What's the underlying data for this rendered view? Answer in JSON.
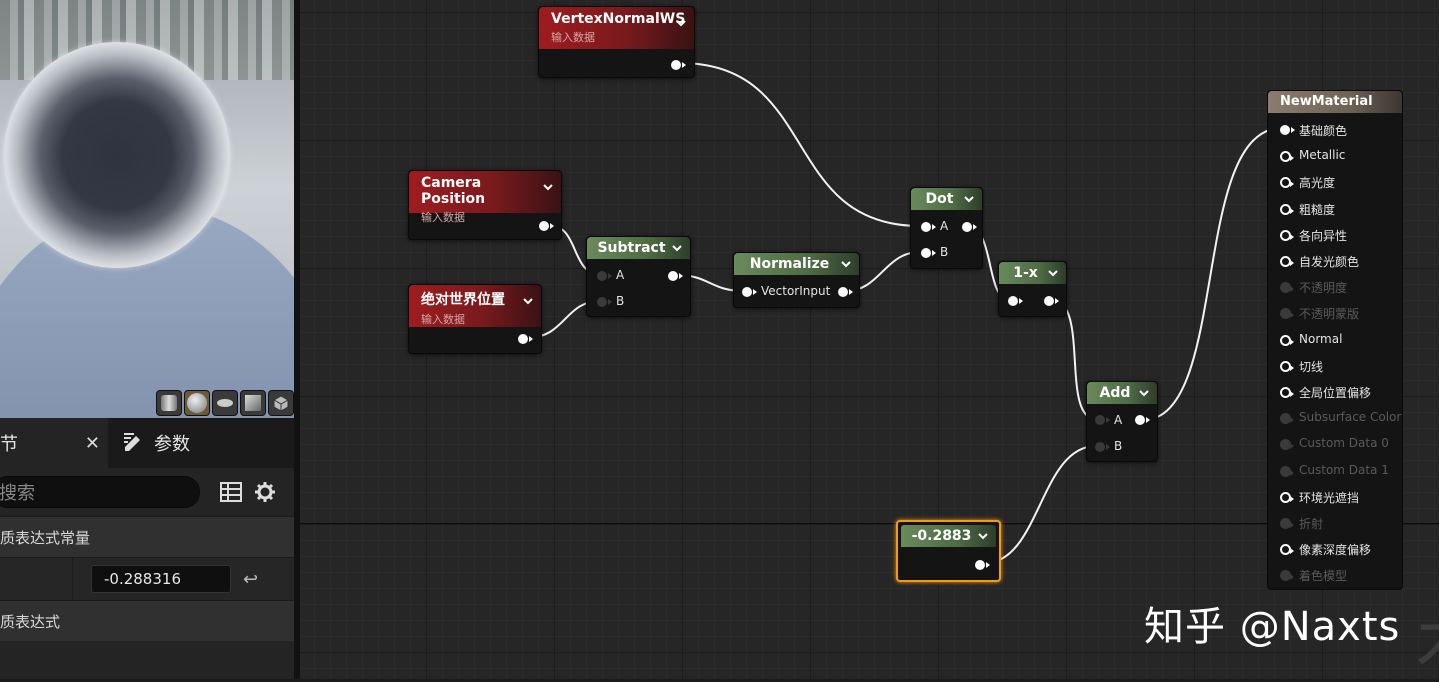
{
  "viewport": {
    "preview_shapes": [
      "cylinder-icon",
      "sphere-icon",
      "plane-icon",
      "cube-icon",
      "custom-mesh-icon"
    ]
  },
  "details": {
    "tab_details": "节",
    "tab_params": "参数",
    "search_placeholder": "搜索",
    "section1": "质表达式常量",
    "value": "-0.288316",
    "section2": "质表达式"
  },
  "nodes": {
    "vertex_normal": {
      "title": "VertexNormalWS",
      "sub": "输入数据"
    },
    "camera_position": {
      "title": "Camera Position",
      "sub": "输入数据"
    },
    "absolute_world_pos": {
      "title": "绝对世界位置",
      "sub": "输入数据"
    },
    "subtract": {
      "title": "Subtract",
      "pin_a": "A",
      "pin_b": "B"
    },
    "normalize": {
      "title": "Normalize",
      "pin_in": "VectorInput"
    },
    "dot": {
      "title": "Dot",
      "pin_a": "A",
      "pin_b": "B"
    },
    "one_minus": {
      "title": "1-x"
    },
    "add": {
      "title": "Add",
      "pin_a": "A",
      "pin_b": "B"
    },
    "constant": {
      "title": "-0.2883"
    }
  },
  "material": {
    "title": "NewMaterial",
    "inputs": [
      {
        "label": "基础颜色",
        "enabled": true,
        "connected": true
      },
      {
        "label": "Metallic",
        "enabled": true,
        "connected": false
      },
      {
        "label": "高光度",
        "enabled": true,
        "connected": false
      },
      {
        "label": "粗糙度",
        "enabled": true,
        "connected": false
      },
      {
        "label": "各向异性",
        "enabled": true,
        "connected": false
      },
      {
        "label": "自发光颜色",
        "enabled": true,
        "connected": false
      },
      {
        "label": "不透明度",
        "enabled": false,
        "connected": false
      },
      {
        "label": "不透明蒙版",
        "enabled": false,
        "connected": false
      },
      {
        "label": "Normal",
        "enabled": true,
        "connected": false
      },
      {
        "label": "切线",
        "enabled": true,
        "connected": false
      },
      {
        "label": "全局位置偏移",
        "enabled": true,
        "connected": false
      },
      {
        "label": "Subsurface Color",
        "enabled": false,
        "connected": false
      },
      {
        "label": "Custom Data 0",
        "enabled": false,
        "connected": false
      },
      {
        "label": "Custom Data 1",
        "enabled": false,
        "connected": false
      },
      {
        "label": "环境光遮挡",
        "enabled": true,
        "connected": false
      },
      {
        "label": "折射",
        "enabled": false,
        "connected": false
      },
      {
        "label": "像素深度偏移",
        "enabled": true,
        "connected": false
      },
      {
        "label": "着色模型",
        "enabled": false,
        "connected": false
      }
    ]
  },
  "watermark": "知乎 @Naxts",
  "colors": {
    "selection": "#f39c12",
    "input_node": "#9e1c20",
    "math_node": "#6a8a5c",
    "material_node": "#8a7d70"
  }
}
